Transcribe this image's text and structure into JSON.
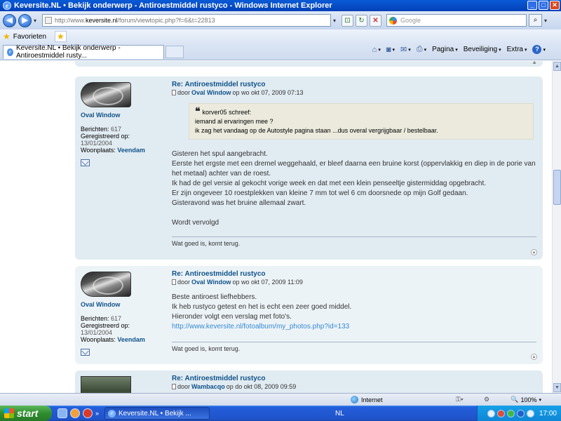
{
  "window": {
    "title": "Keversite.NL • Bekijk onderwerp - Antiroestmiddel rustyco - Windows Internet Explorer"
  },
  "browser": {
    "url_prefix": "http://www.",
    "url_domain": "keversite.nl",
    "url_path": "/forum/viewtopic.php?f=6&t=22813",
    "search_placeholder": "Google",
    "favorites_label": "Favorieten",
    "tab_label": "Keversite.NL • Bekijk onderwerp - Antiroestmiddel rusty...",
    "commands": {
      "page": "Pagina",
      "security": "Beveiliging",
      "extra": "Extra"
    }
  },
  "posts": [
    {
      "username": "Oval Window",
      "title": "Re: Antiroestmiddel rustyco",
      "meta_prefix": "door",
      "author": "Oval Window",
      "meta_suffix": "op wo okt 07, 2009 07:13",
      "profile": {
        "posts_label": "Berichten:",
        "posts": "617",
        "registered_label": "Geregistreerd op:",
        "registered": "13/01/2004",
        "location_label": "Woonplaats:",
        "location": "Veendam"
      },
      "quote": {
        "author_line": "korver05 schreef:",
        "line1": "iemand al ervaringen mee ?",
        "line2": "ik zag het vandaag op de Autostyle pagina staan ...dus overal vergrijgbaar / bestelbaar."
      },
      "body": [
        "Gisteren het spul aangebracht.",
        "Eerste het ergste met een dremel weggehaald, er bleef daarna een bruine korst (oppervlakkig en diep in de porie van het metaal) achter van de roest.",
        "Ik had de gel versie al gekocht vorige week en dat met een klein penseeltje gistermiddag opgebracht.",
        "Er zijn ongeveer 10 roestplekken van kleine 7 mm tot wel 6 cm doorsnede op mijn Golf gedaan.",
        "Gisteravond was het bruine allemaal zwart.",
        "Wordt vervolgd"
      ],
      "signature": "Wat goed is, komt terug."
    },
    {
      "username": "Oval Window",
      "title": "Re: Antiroestmiddel rustyco",
      "meta_prefix": "door",
      "author": "Oval Window",
      "meta_suffix": "op wo okt 07, 2009 11:09",
      "profile": {
        "posts_label": "Berichten:",
        "posts": "617",
        "registered_label": "Geregistreerd op:",
        "registered": "13/01/2004",
        "location_label": "Woonplaats:",
        "location": "Veendam"
      },
      "body": [
        "Beste antiroest liefhebbers.",
        "Ik heb rustyco getest en het is echt een zeer goed middel.",
        "Hieronder volgt een verslag met foto's."
      ],
      "link": "http://www.keversite.nl/fotoalbum/my_photos.php?id=133",
      "signature": "Wat goed is, komt terug."
    },
    {
      "title": "Re: Antiroestmiddel rustyco",
      "meta_prefix": "door",
      "author": "Wambacqo",
      "meta_suffix": "op do okt 08, 2009 09:59"
    }
  ],
  "status": {
    "zone": "Internet",
    "zoom": "100%"
  },
  "taskbar": {
    "start": "start",
    "task_item": "Keversite.NL • Bekijk ...",
    "language": "NL",
    "clock": "17:00"
  },
  "colors": {
    "post_bg": "#e1ebf2",
    "post_alt_bg": "#ecf3f7",
    "link": "#105289",
    "xp_blue": "#245edb",
    "start_green": "#2f8d2f"
  }
}
